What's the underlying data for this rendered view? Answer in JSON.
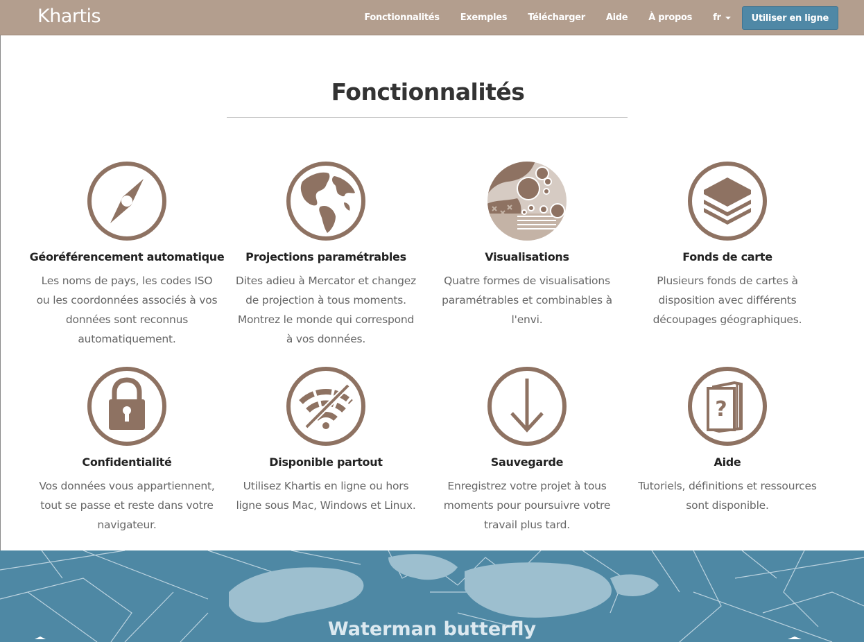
{
  "nav": {
    "brand": "Khartis",
    "links": [
      "Fonctionnalités",
      "Exemples",
      "Télécharger",
      "Aide",
      "À propos"
    ],
    "lang": "fr",
    "cta": "Utiliser en ligne"
  },
  "section": {
    "title": "Fonctionnalités"
  },
  "features": [
    {
      "title": "Géoréférencement automatique",
      "text": "Les noms de pays, les codes ISO ou les coordonnées associés à vos données sont reconnus automatiquement.",
      "icon": "compass-icon"
    },
    {
      "title": "Projections paramétrables",
      "text": "Dites adieu à Mercator et changez de projection à tous moments. Montrez le monde qui correspond à vos données.",
      "icon": "globe-icon"
    },
    {
      "title": "Visualisations",
      "text": "Quatre formes de visualisations paramétrables et combinables à l'envi.",
      "icon": "visualisation-icon"
    },
    {
      "title": "Fonds de carte",
      "text": "Plusieurs fonds de cartes à disposition avec différents découpages géographiques.",
      "icon": "layers-icon"
    },
    {
      "title": "Confidentialité",
      "text": "Vos données vous appartiennent, tout se passe et reste dans votre navigateur.",
      "icon": "lock-icon"
    },
    {
      "title": "Disponible partout",
      "text": "Utilisez Khartis en ligne ou hors ligne sous Mac, Windows et Linux.",
      "icon": "offline-wifi-icon"
    },
    {
      "title": "Sauvegarde",
      "text": "Enregistrez votre projet à tous moments pour poursuivre votre travail plus tard.",
      "icon": "download-icon"
    },
    {
      "title": "Aide",
      "text": "Tutoriels, définitions et ressources sont disponible.",
      "icon": "help-book-icon"
    }
  ],
  "map_band": {
    "caption": "Waterman butterfly"
  },
  "colors": {
    "navbar": "#b39e8e",
    "accent": "#4f88a6",
    "icon": "#8e7262",
    "map": "#4e88a4"
  }
}
